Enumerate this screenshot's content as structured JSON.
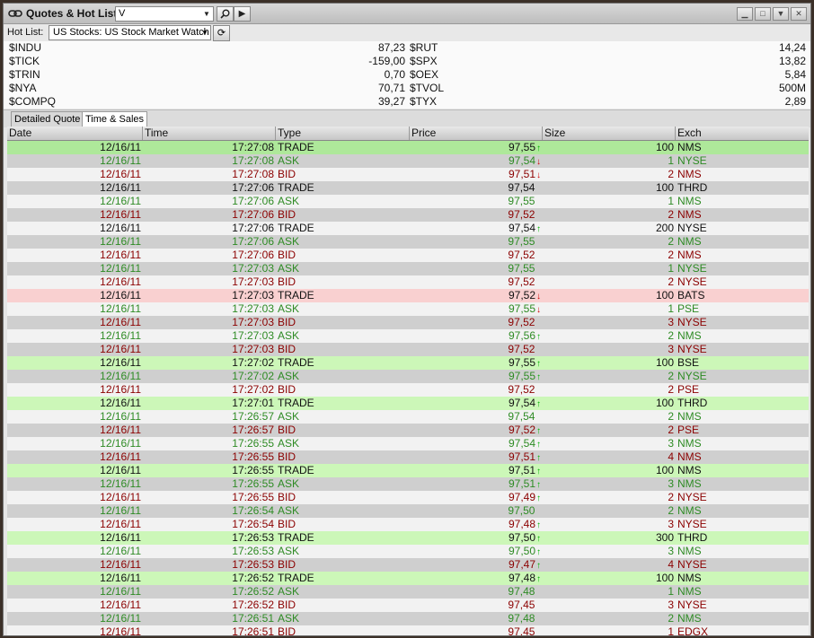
{
  "window": {
    "title": "Quotes & Hot List",
    "symbol": "V"
  },
  "hotlist": {
    "label": "Hot List:",
    "selected": "US Stocks: US Stock Market Watch"
  },
  "indices": {
    "left": [
      {
        "name": "$INDU",
        "value": "87,23"
      },
      {
        "name": "$TICK",
        "value": "-159,00"
      },
      {
        "name": "$TRIN",
        "value": "0,70"
      },
      {
        "name": "$NYA",
        "value": "70,71"
      },
      {
        "name": "$COMPQ",
        "value": "39,27"
      }
    ],
    "right": [
      {
        "name": "$RUT",
        "value": "14,24"
      },
      {
        "name": "$SPX",
        "value": "13,82"
      },
      {
        "name": "$OEX",
        "value": "5,84"
      },
      {
        "name": "$TVOL",
        "value": "500M"
      },
      {
        "name": "$TYX",
        "value": "2,89"
      }
    ]
  },
  "tabs": [
    {
      "label": "Detailed Quote",
      "active": false
    },
    {
      "label": "Time & Sales",
      "active": true
    }
  ],
  "columns": [
    "Date",
    "Time",
    "Type",
    "Price",
    "Size",
    "Exch"
  ],
  "colors": {
    "ask": "#2e8b24",
    "bid": "#8b0000",
    "trade": "#111111",
    "trade_bg": "#ccf7b8",
    "trade_bg_selected": "#aee89a",
    "trade_down_bg": "#f9d0d0",
    "stripe_light": "#f2f2f2",
    "stripe_dark": "#cfcfcf"
  },
  "rows": [
    {
      "date": "12/16/11",
      "time": "17:27:08",
      "type": "TRADE",
      "price": "97,55",
      "arrow": "up",
      "size": "100",
      "exch": "NMS",
      "highlight": "selected"
    },
    {
      "date": "12/16/11",
      "time": "17:27:08",
      "type": "ASK",
      "price": "97,54",
      "arrow": "down",
      "size": "1",
      "exch": "NYSE"
    },
    {
      "date": "12/16/11",
      "time": "17:27:08",
      "type": "BID",
      "price": "97,51",
      "arrow": "down",
      "size": "2",
      "exch": "NMS"
    },
    {
      "date": "12/16/11",
      "time": "17:27:06",
      "type": "TRADE",
      "price": "97,54",
      "arrow": "",
      "size": "100",
      "exch": "THRD"
    },
    {
      "date": "12/16/11",
      "time": "17:27:06",
      "type": "ASK",
      "price": "97,55",
      "arrow": "",
      "size": "1",
      "exch": "NMS"
    },
    {
      "date": "12/16/11",
      "time": "17:27:06",
      "type": "BID",
      "price": "97,52",
      "arrow": "",
      "size": "2",
      "exch": "NMS"
    },
    {
      "date": "12/16/11",
      "time": "17:27:06",
      "type": "TRADE",
      "price": "97,54",
      "arrow": "up",
      "size": "200",
      "exch": "NYSE"
    },
    {
      "date": "12/16/11",
      "time": "17:27:06",
      "type": "ASK",
      "price": "97,55",
      "arrow": "",
      "size": "2",
      "exch": "NMS"
    },
    {
      "date": "12/16/11",
      "time": "17:27:06",
      "type": "BID",
      "price": "97,52",
      "arrow": "",
      "size": "2",
      "exch": "NMS"
    },
    {
      "date": "12/16/11",
      "time": "17:27:03",
      "type": "ASK",
      "price": "97,55",
      "arrow": "",
      "size": "1",
      "exch": "NYSE"
    },
    {
      "date": "12/16/11",
      "time": "17:27:03",
      "type": "BID",
      "price": "97,52",
      "arrow": "",
      "size": "2",
      "exch": "NYSE"
    },
    {
      "date": "12/16/11",
      "time": "17:27:03",
      "type": "TRADE",
      "price": "97,52",
      "arrow": "down",
      "size": "100",
      "exch": "BATS",
      "highlight": "down"
    },
    {
      "date": "12/16/11",
      "time": "17:27:03",
      "type": "ASK",
      "price": "97,55",
      "arrow": "down",
      "size": "1",
      "exch": "PSE"
    },
    {
      "date": "12/16/11",
      "time": "17:27:03",
      "type": "BID",
      "price": "97,52",
      "arrow": "",
      "size": "3",
      "exch": "NYSE"
    },
    {
      "date": "12/16/11",
      "time": "17:27:03",
      "type": "ASK",
      "price": "97,56",
      "arrow": "up",
      "size": "2",
      "exch": "NMS"
    },
    {
      "date": "12/16/11",
      "time": "17:27:03",
      "type": "BID",
      "price": "97,52",
      "arrow": "",
      "size": "3",
      "exch": "NYSE"
    },
    {
      "date": "12/16/11",
      "time": "17:27:02",
      "type": "TRADE",
      "price": "97,55",
      "arrow": "up",
      "size": "100",
      "exch": "BSE",
      "highlight": "up"
    },
    {
      "date": "12/16/11",
      "time": "17:27:02",
      "type": "ASK",
      "price": "97,55",
      "arrow": "up",
      "size": "2",
      "exch": "NYSE"
    },
    {
      "date": "12/16/11",
      "time": "17:27:02",
      "type": "BID",
      "price": "97,52",
      "arrow": "",
      "size": "2",
      "exch": "PSE"
    },
    {
      "date": "12/16/11",
      "time": "17:27:01",
      "type": "TRADE",
      "price": "97,54",
      "arrow": "up",
      "size": "100",
      "exch": "THRD",
      "highlight": "up"
    },
    {
      "date": "12/16/11",
      "time": "17:26:57",
      "type": "ASK",
      "price": "97,54",
      "arrow": "",
      "size": "2",
      "exch": "NMS"
    },
    {
      "date": "12/16/11",
      "time": "17:26:57",
      "type": "BID",
      "price": "97,52",
      "arrow": "up",
      "size": "2",
      "exch": "PSE"
    },
    {
      "date": "12/16/11",
      "time": "17:26:55",
      "type": "ASK",
      "price": "97,54",
      "arrow": "up",
      "size": "3",
      "exch": "NMS"
    },
    {
      "date": "12/16/11",
      "time": "17:26:55",
      "type": "BID",
      "price": "97,51",
      "arrow": "up",
      "size": "4",
      "exch": "NMS"
    },
    {
      "date": "12/16/11",
      "time": "17:26:55",
      "type": "TRADE",
      "price": "97,51",
      "arrow": "up",
      "size": "100",
      "exch": "NMS",
      "highlight": "up"
    },
    {
      "date": "12/16/11",
      "time": "17:26:55",
      "type": "ASK",
      "price": "97,51",
      "arrow": "up",
      "size": "3",
      "exch": "NMS"
    },
    {
      "date": "12/16/11",
      "time": "17:26:55",
      "type": "BID",
      "price": "97,49",
      "arrow": "up",
      "size": "2",
      "exch": "NYSE"
    },
    {
      "date": "12/16/11",
      "time": "17:26:54",
      "type": "ASK",
      "price": "97,50",
      "arrow": "",
      "size": "2",
      "exch": "NMS"
    },
    {
      "date": "12/16/11",
      "time": "17:26:54",
      "type": "BID",
      "price": "97,48",
      "arrow": "up",
      "size": "3",
      "exch": "NYSE"
    },
    {
      "date": "12/16/11",
      "time": "17:26:53",
      "type": "TRADE",
      "price": "97,50",
      "arrow": "up",
      "size": "300",
      "exch": "THRD",
      "highlight": "up"
    },
    {
      "date": "12/16/11",
      "time": "17:26:53",
      "type": "ASK",
      "price": "97,50",
      "arrow": "up",
      "size": "3",
      "exch": "NMS"
    },
    {
      "date": "12/16/11",
      "time": "17:26:53",
      "type": "BID",
      "price": "97,47",
      "arrow": "up",
      "size": "4",
      "exch": "NYSE"
    },
    {
      "date": "12/16/11",
      "time": "17:26:52",
      "type": "TRADE",
      "price": "97,48",
      "arrow": "up",
      "size": "100",
      "exch": "NMS",
      "highlight": "up"
    },
    {
      "date": "12/16/11",
      "time": "17:26:52",
      "type": "ASK",
      "price": "97,48",
      "arrow": "",
      "size": "1",
      "exch": "NMS"
    },
    {
      "date": "12/16/11",
      "time": "17:26:52",
      "type": "BID",
      "price": "97,45",
      "arrow": "",
      "size": "3",
      "exch": "NYSE"
    },
    {
      "date": "12/16/11",
      "time": "17:26:51",
      "type": "ASK",
      "price": "97,48",
      "arrow": "",
      "size": "2",
      "exch": "NMS"
    },
    {
      "date": "12/16/11",
      "time": "17:26:51",
      "type": "BID",
      "price": "97,45",
      "arrow": "",
      "size": "1",
      "exch": "EDGX"
    }
  ]
}
